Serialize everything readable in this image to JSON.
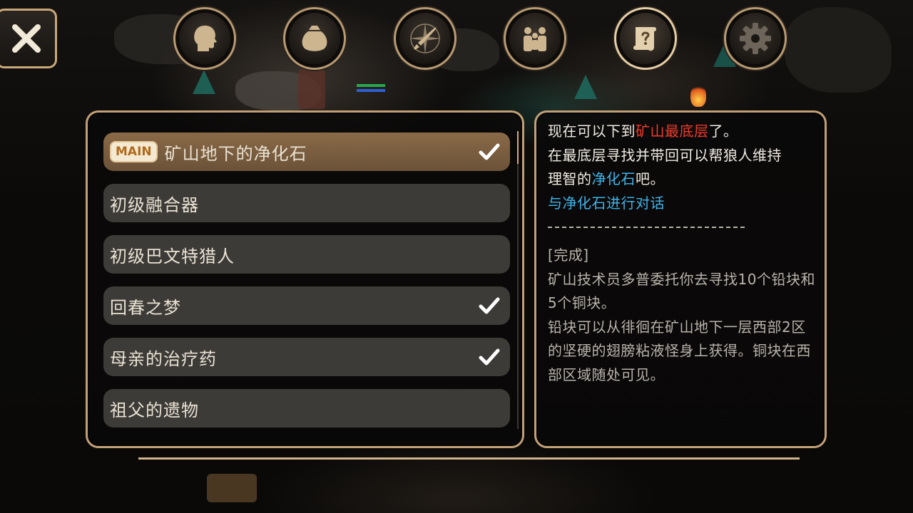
{
  "ui": {
    "close_icon": "close-x-icon",
    "accent_color": "#c2a077",
    "nav": [
      {
        "icon": "character-head-icon",
        "active": false
      },
      {
        "icon": "inventory-bag-icon",
        "active": false
      },
      {
        "icon": "skills-compass-sword-icon",
        "active": false
      },
      {
        "icon": "party-people-icon",
        "active": false
      },
      {
        "icon": "quest-scroll-icon",
        "active": true
      },
      {
        "icon": "settings-gear-icon",
        "active": false
      }
    ]
  },
  "quests": [
    {
      "badge": "MAIN",
      "label": "矿山地下的净化石",
      "completed": true,
      "selected": true
    },
    {
      "badge": "",
      "label": "初级融合器",
      "completed": false,
      "selected": false
    },
    {
      "badge": "",
      "label": "初级巴文特猎人",
      "completed": false,
      "selected": false
    },
    {
      "badge": "",
      "label": "回春之梦",
      "completed": true,
      "selected": false
    },
    {
      "badge": "",
      "label": "母亲的治疗药",
      "completed": true,
      "selected": false
    },
    {
      "badge": "",
      "label": "祖父的遗物",
      "completed": false,
      "selected": false
    }
  ],
  "detail": {
    "line1_prefix": "现在可以下到",
    "line1_highlight": "矿山最底层",
    "line1_suffix": "了。",
    "line2": "在最底层寻找并带回可以帮狼人维持",
    "line3_prefix": "理智的",
    "line3_highlight": "净化石",
    "line3_suffix": "吧。",
    "action": "与净化石进行对话",
    "status": "[完成]",
    "completed_p1": "矿山技术员多普委托你去寻找10个铅块和5个铜块。",
    "completed_p2": "铅块可以从徘徊在矿山地下一层西部2区的坚硬的翅膀粘液怪身上获得。铜块在西部区域随处可见。",
    "highlight_red": "#ef3b2c",
    "highlight_blue": "#3fb4ea"
  }
}
